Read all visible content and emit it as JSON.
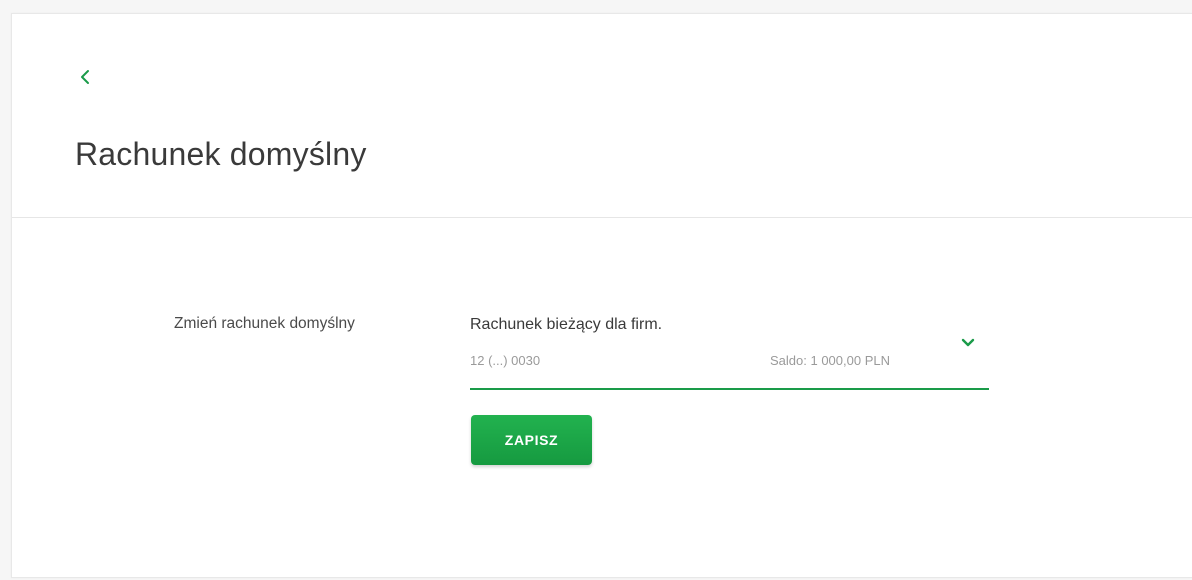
{
  "header": {
    "back_icon": "chevron-left-icon",
    "title": "Rachunek domyślny"
  },
  "form": {
    "label": "Zmień rachunek domyślny",
    "account_select": {
      "name": "Rachunek bieżący dla firm.",
      "number": "12 (...) 0030",
      "balance": "Saldo: 1 000,00 PLN",
      "dropdown_icon": "chevron-down-icon"
    },
    "save_label": "ZAPISZ"
  },
  "colors": {
    "accent": "#1a9b49",
    "button": "#1ca447",
    "background": "#f6f6f6",
    "card": "#ffffff"
  }
}
